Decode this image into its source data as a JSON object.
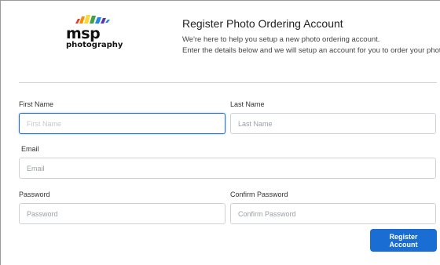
{
  "brand": {
    "name": "msp",
    "tagline": "photography",
    "stripe_colors": [
      "#e53935",
      "#fb8c00",
      "#fdd835",
      "#43a047",
      "#1e88e5",
      "#5e35b1"
    ]
  },
  "header": {
    "title": "Register Photo Ordering Account",
    "line1": "We're here to help you setup a new photo ordering account.",
    "line2": "Enter the details below and we will setup an account for you to order your photos."
  },
  "form": {
    "first_name": {
      "label": "First Name",
      "placeholder": "First Name",
      "value": ""
    },
    "last_name": {
      "label": "Last Name",
      "placeholder": "Last Name",
      "value": ""
    },
    "email": {
      "label": "Email",
      "placeholder": "Email",
      "value": ""
    },
    "password": {
      "label": "Password",
      "placeholder": "Password",
      "value": ""
    },
    "confirm_password": {
      "label": "Confirm Password",
      "placeholder": "Confirm Password",
      "value": ""
    },
    "submit_label": "Register Account"
  },
  "colors": {
    "accent": "#1a6ed3",
    "focus_border": "#1f6fd1"
  }
}
